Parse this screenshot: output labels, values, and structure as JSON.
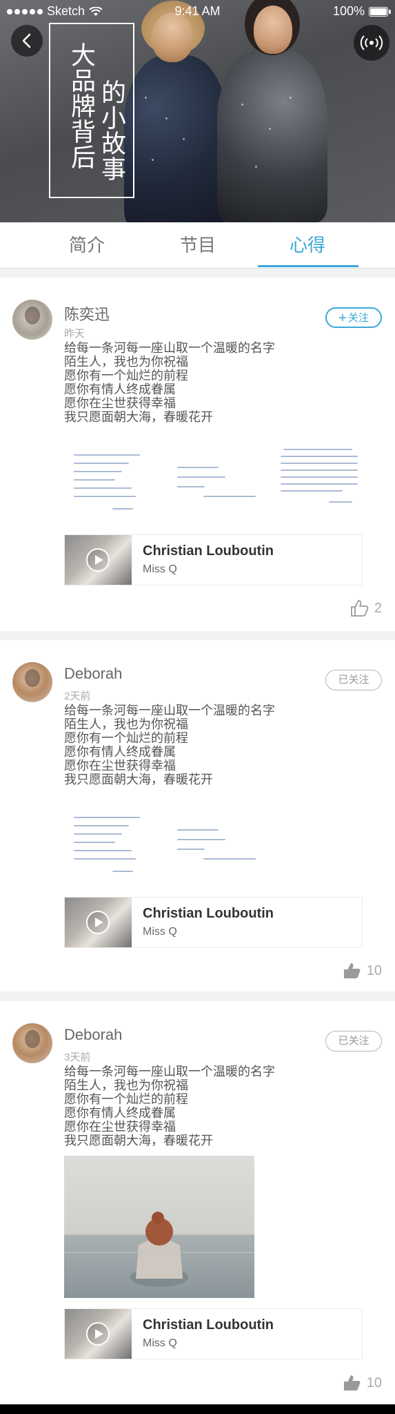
{
  "status_bar": {
    "carrier": "Sketch",
    "time": "9:41 AM",
    "battery": "100%"
  },
  "hero": {
    "title_col_1": "大品牌背后",
    "title_col_2": "的小故事"
  },
  "tabs": [
    {
      "label": "简介",
      "active": false
    },
    {
      "label": "节目",
      "active": false
    },
    {
      "label": "心得",
      "active": true
    }
  ],
  "colors": {
    "accent": "#3aa8d8"
  },
  "posts": [
    {
      "author": "陈奕迅",
      "time": "昨天",
      "follow_label": "关注",
      "follow_state": "not-followed",
      "lines": [
        "给每一条河每一座山取一个温暖的名字",
        "陌生人，我也为你祝福",
        "愿你有一个灿烂的前程",
        "愿你有情人终成眷属",
        "愿你在尘世获得幸福",
        "我只愿面朝大海，春暖花开"
      ],
      "media": {
        "title": "Christian Louboutin",
        "subtitle": "Miss Q"
      },
      "likes": "2",
      "liked": false
    },
    {
      "author": "Deborah",
      "time": "2天前",
      "follow_label": "已关注",
      "follow_state": "followed",
      "lines": [
        "给每一条河每一座山取一个温暖的名字",
        "陌生人，我也为你祝福",
        "愿你有一个灿烂的前程",
        "愿你有情人终成眷属",
        "愿你在尘世获得幸福",
        "我只愿面朝大海，春暖花开"
      ],
      "media": {
        "title": "Christian Louboutin",
        "subtitle": "Miss Q"
      },
      "likes": "10",
      "liked": true
    },
    {
      "author": "Deborah",
      "time": "3天前",
      "follow_label": "已关注",
      "follow_state": "followed",
      "lines": [
        "给每一条河每一座山取一个温暖的名字",
        "陌生人，我也为你祝福",
        "愿你有一个灿烂的前程",
        "愿你有情人终成眷属",
        "愿你在尘世获得幸福",
        "我只愿面朝大海，春暖花开"
      ],
      "media": {
        "title": "Christian Louboutin",
        "subtitle": "Miss Q"
      },
      "likes": "10",
      "liked": true
    }
  ]
}
